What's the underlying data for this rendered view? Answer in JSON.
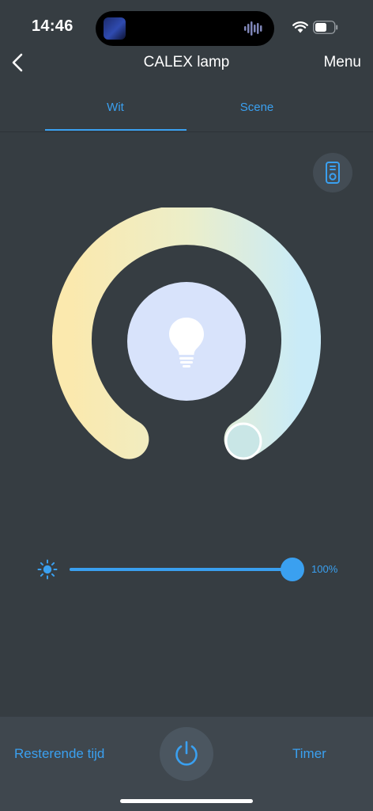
{
  "status_bar": {
    "time": "14:46"
  },
  "nav": {
    "title": "CALEX lamp",
    "menu_label": "Menu"
  },
  "tabs": [
    {
      "label": "Wit",
      "active": true
    },
    {
      "label": "Scene",
      "active": false
    }
  ],
  "brightness": {
    "value_label": "100%",
    "level": 1.0
  },
  "bottom_bar": {
    "left_label": "Resterende tijd",
    "right_label": "Timer"
  },
  "colors": {
    "accent": "#3aa0f0",
    "background": "#363d42",
    "bottom_bar": "#3f474e",
    "warm_white": "#fbe9ae",
    "cool_white": "#c9ebf8",
    "bulb_circle": "#d8e3fb"
  },
  "icons": {
    "back": "chevron-left-icon",
    "remote": "remote-control-icon",
    "bulb": "light-bulb-icon",
    "brightness": "sun-icon",
    "power": "power-icon"
  }
}
